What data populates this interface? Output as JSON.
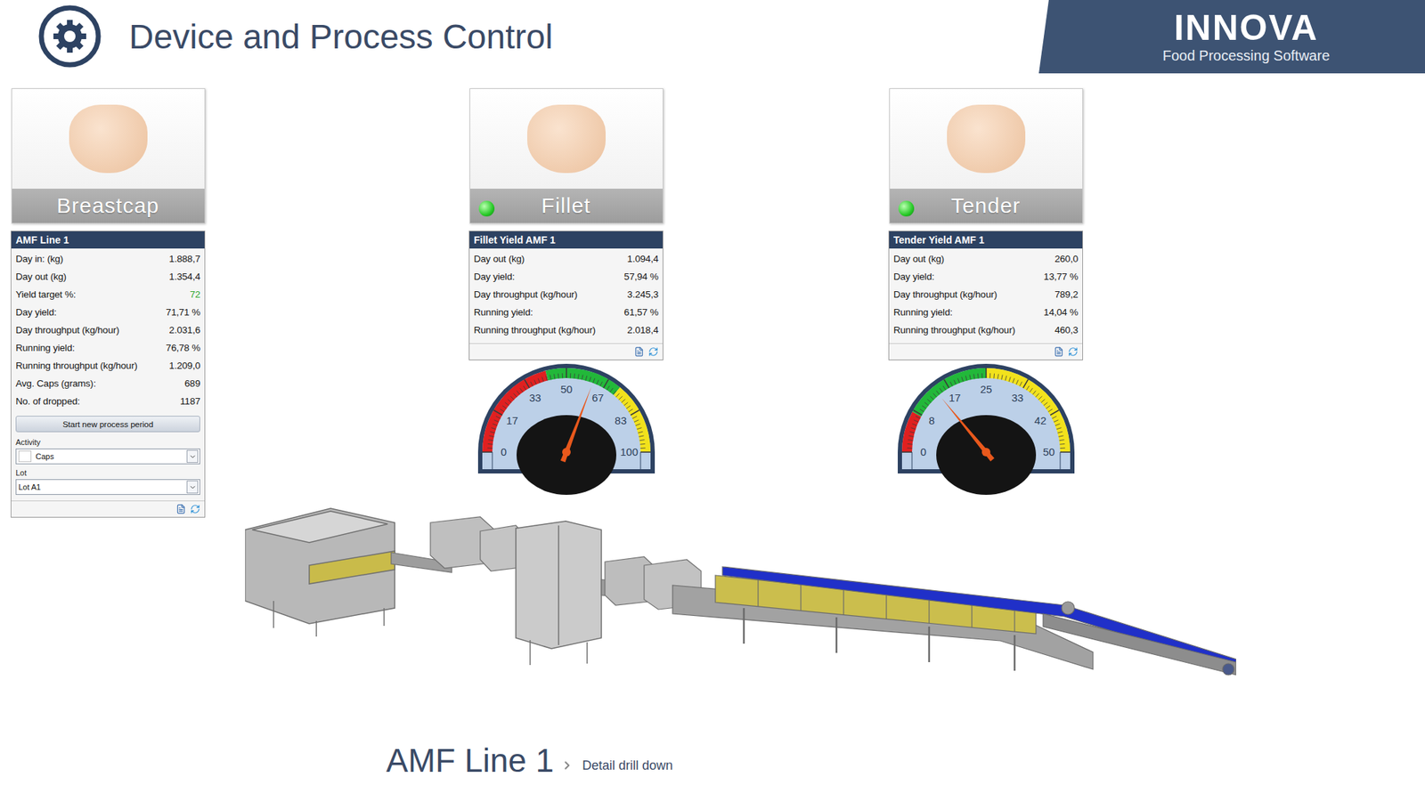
{
  "header": {
    "title": "Device and Process Control",
    "logo": {
      "name": "INNOVA",
      "tagline": "Food Processing Software"
    }
  },
  "products": [
    {
      "name": "Breastcap",
      "status_light": false,
      "panel": {
        "title": "AMF Line 1",
        "rows": [
          {
            "label": "Day in: (kg)",
            "value": "1.888,7"
          },
          {
            "label": "Day out (kg)",
            "value": "1.354,4"
          },
          {
            "label": "Yield target %:",
            "value": "72",
            "color": "#2fa52f"
          },
          {
            "label": "Day yield:",
            "value": "71,71 %"
          },
          {
            "label": "Day throughput (kg/hour)",
            "value": "2.031,6"
          },
          {
            "label": "Running yield:",
            "value": "76,78 %"
          },
          {
            "label": "Running throughput (kg/hour)",
            "value": "1.209,0"
          },
          {
            "label": "Avg. Caps (grams):",
            "value": "689"
          },
          {
            "label": "No. of dropped:",
            "value": "1187"
          }
        ],
        "button": "Start new process period",
        "fields": [
          {
            "label": "Activity",
            "value": "Caps",
            "swatch": true
          },
          {
            "label": "Lot",
            "value": "Lot A1",
            "swatch": false
          }
        ]
      }
    },
    {
      "name": "Fillet",
      "status_light": true,
      "status_color": "#27c927",
      "panel": {
        "title": "Fillet Yield AMF 1",
        "rows": [
          {
            "label": "Day out (kg)",
            "value": "1.094,4"
          },
          {
            "label": "Day yield:",
            "value": "57,94 %"
          },
          {
            "label": "Day throughput (kg/hour)",
            "value": "3.245,3"
          },
          {
            "label": "Running yield:",
            "value": "61,57 %"
          },
          {
            "label": "Running throughput (kg/hour)",
            "value": "2.018,4"
          }
        ]
      },
      "gauge": {
        "level": 0.6157,
        "ticks": [
          "0",
          "17",
          "33",
          "50",
          "67",
          "83",
          "100"
        ],
        "bands": [
          {
            "color": "#e02020",
            "from": 0,
            "to": 0.42
          },
          {
            "color": "#22b83a",
            "from": 0.42,
            "to": 0.72
          },
          {
            "color": "#f2e21c",
            "from": 0.72,
            "to": 1
          }
        ]
      }
    },
    {
      "name": "Tender",
      "status_light": true,
      "status_color": "#27c927",
      "panel": {
        "title": "Tender Yield AMF 1",
        "rows": [
          {
            "label": "Day out (kg)",
            "value": "260,0"
          },
          {
            "label": "Day yield:",
            "value": "13,77 %"
          },
          {
            "label": "Day throughput (kg/hour)",
            "value": "789,2"
          },
          {
            "label": "Running yield:",
            "value": "14,04 %"
          },
          {
            "label": "Running throughput (kg/hour)",
            "value": "460,3"
          }
        ]
      },
      "gauge": {
        "level": 0.2808,
        "ticks": [
          "0",
          "8",
          "17",
          "25",
          "33",
          "42",
          "50"
        ],
        "bands": [
          {
            "color": "#e02020",
            "from": 0,
            "to": 0.16
          },
          {
            "color": "#22b83a",
            "from": 0.16,
            "to": 0.5
          },
          {
            "color": "#f2e21c",
            "from": 0.5,
            "to": 1
          }
        ]
      }
    }
  ],
  "caption": {
    "title": "AMF Line 1",
    "link": "Detail drill down"
  }
}
